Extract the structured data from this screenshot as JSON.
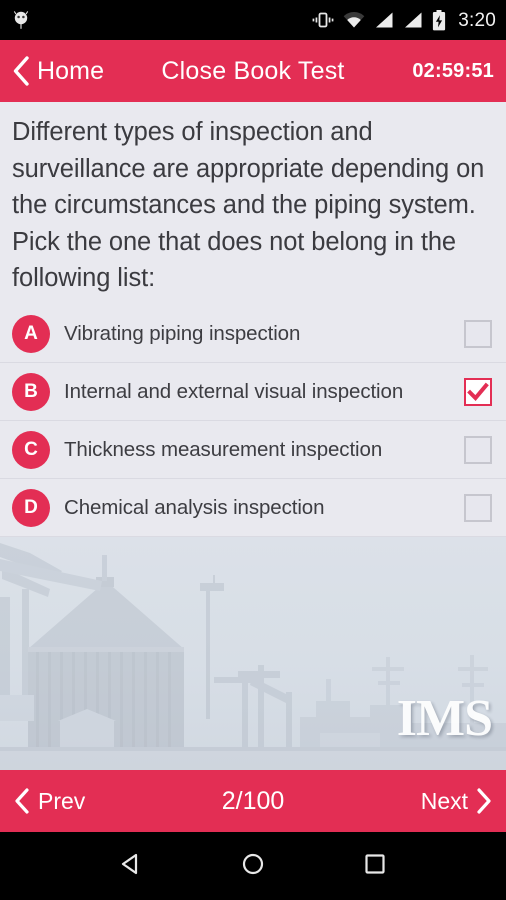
{
  "status_bar": {
    "notification_icon": "android-robot-icon",
    "vibrate_icon": "vibrate-icon",
    "wifi_icon": "wifi-icon",
    "signal_icon_1": "signal-bars-icon",
    "signal_icon_2": "signal-bars-icon",
    "battery_icon": "battery-charging-icon",
    "clock": "3:20"
  },
  "app_bar": {
    "back_icon": "chevron-left-icon",
    "home_label": "Home",
    "title": "Close Book Test",
    "timer": "02:59:51",
    "background_color": "#e32e54"
  },
  "question": {
    "text": "Different types of inspection and surveillance are appropriate depending on the circumstances and the piping system. Pick the one that does not belong in the following list:"
  },
  "options": [
    {
      "badge": "A",
      "label": "Vibrating piping inspection",
      "checked": false
    },
    {
      "badge": "B",
      "label": "Internal and external visual inspection",
      "checked": true
    },
    {
      "badge": "C",
      "label": "Thickness measurement inspection",
      "checked": false
    },
    {
      "badge": "D",
      "label": "Chemical analysis inspection",
      "checked": false
    }
  ],
  "image_area": {
    "description": "industrial-port-photo",
    "watermark": "IMS"
  },
  "quiz_nav": {
    "prev_icon": "chevron-left-icon",
    "prev_label": "Prev",
    "page_indicator": "2/100",
    "next_label": "Next",
    "next_icon": "chevron-right-icon",
    "background_color": "#e32e54"
  },
  "system_nav": {
    "back_icon": "triangle-back-icon",
    "home_icon": "circle-home-icon",
    "recents_icon": "square-recents-icon"
  },
  "colors": {
    "accent": "#e32e54",
    "content_bg": "#e9e9ef",
    "text": "#3b3b40",
    "divider": "#dadae2"
  }
}
